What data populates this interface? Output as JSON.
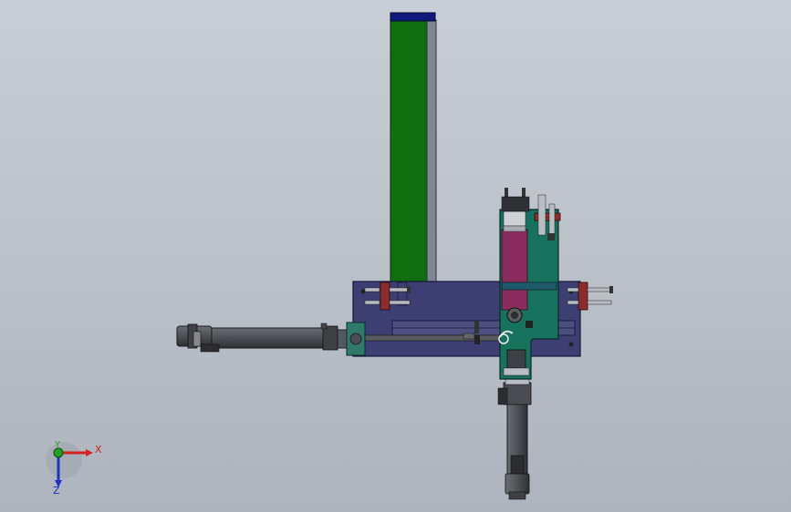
{
  "triad": {
    "x_label": "X",
    "y_label": "Y",
    "z_label": "Z",
    "x_color": "#d42020",
    "y_color": "#20a020",
    "z_color": "#2030c8"
  },
  "colors": {
    "column": "#0f6e0f",
    "column_cap": "#101a7a",
    "base_plate": "#3d3f73",
    "carriage": "#16715d",
    "slider": "#8b2c5e",
    "clamp": "#8b2d2d",
    "cylinder": "#4b4d52"
  }
}
